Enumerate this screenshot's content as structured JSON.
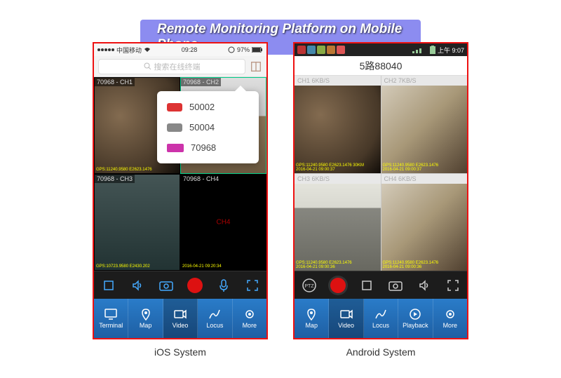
{
  "banner": "Remote Monitoring Platform on Mobile Phone",
  "ios": {
    "carrier": "中国移动",
    "time": "09:28",
    "battery": "97%",
    "search_placeholder": "搜索在线终端",
    "tiles": [
      {
        "label": "70968 - CH1"
      },
      {
        "label": "70968 - CH2"
      },
      {
        "label": "70968 - CH3"
      },
      {
        "label": "70968 - CH4"
      }
    ],
    "popup": [
      {
        "id": "50002",
        "type": "car-red"
      },
      {
        "id": "50004",
        "type": "car-grey"
      },
      {
        "id": "70968",
        "type": "bus"
      }
    ],
    "nav": [
      {
        "key": "terminal",
        "label": "Terminal"
      },
      {
        "key": "map",
        "label": "Map"
      },
      {
        "key": "video",
        "label": "Video"
      },
      {
        "key": "locus",
        "label": "Locus"
      },
      {
        "key": "more",
        "label": "More"
      }
    ],
    "caption": "iOS System"
  },
  "android": {
    "time": "上午 9:07",
    "title": "5路88040",
    "tiles": [
      {
        "label": "CH1 6KB/S"
      },
      {
        "label": "CH2 7KB/S"
      },
      {
        "label": "CH3 6KB/S"
      },
      {
        "label": "CH4 6KB/S"
      }
    ],
    "nav": [
      {
        "key": "map",
        "label": "Map"
      },
      {
        "key": "video",
        "label": "Video"
      },
      {
        "key": "locus",
        "label": "Locus"
      },
      {
        "key": "playback",
        "label": "Playback"
      },
      {
        "key": "more",
        "label": "More"
      }
    ],
    "caption": "Android System"
  }
}
